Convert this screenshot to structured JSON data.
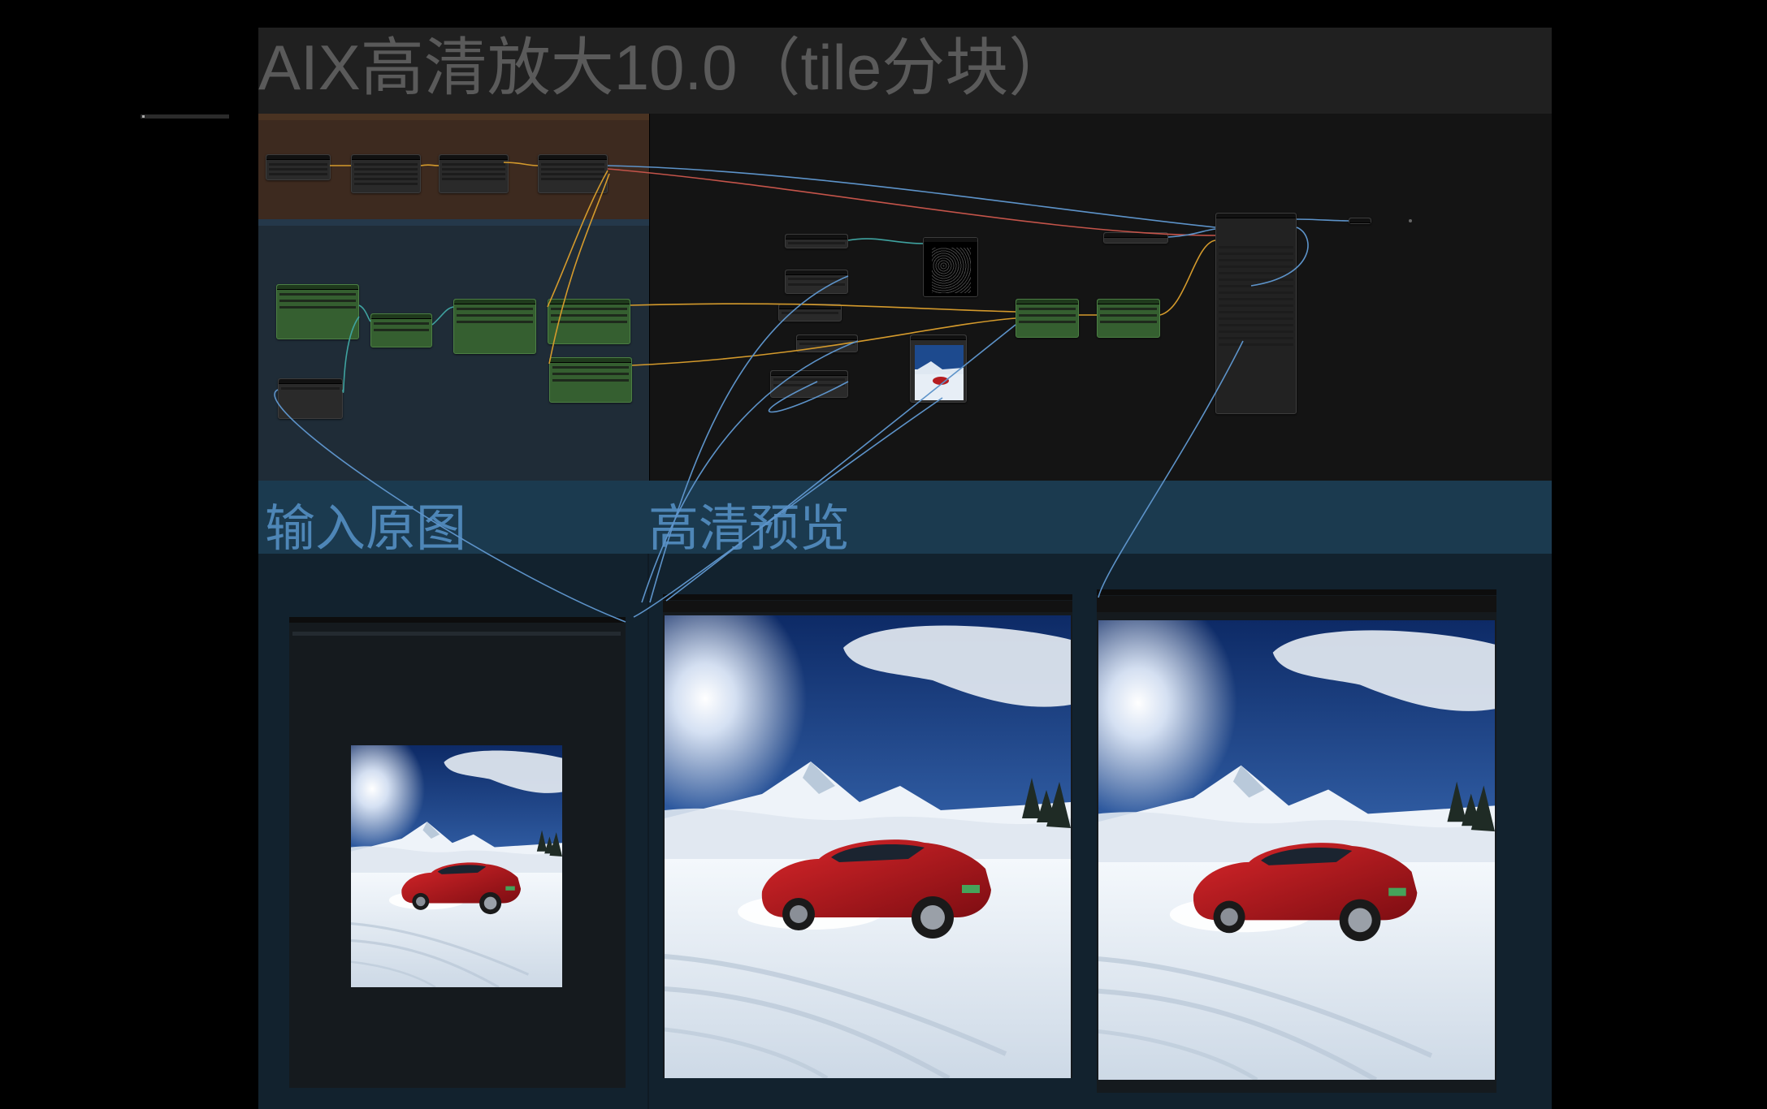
{
  "workflow": {
    "title": "AIX高清放大10.0（tile分块）"
  },
  "groups": {
    "input_label": "输入原图",
    "preview_label": "高清预览"
  },
  "colors": {
    "canvas_bg": "#000000",
    "title_group_bg": "#202020",
    "load_group_bg": "#3d2a1f",
    "sampler_group_bg": "#1f2c37",
    "output_group_bg": "#141414",
    "label_band_bg": "#1b3a4f",
    "images_group_bg": "#12222e",
    "node_green": "#355f30",
    "node_dark": "#2a2a2a",
    "link_blue": "#5d93c9",
    "link_orange": "#d49a2c",
    "link_red": "#c4544a",
    "link_teal": "#3fa3a0"
  },
  "images": {
    "input_image": "snowy-red-car-scene",
    "preview_before": "snowy-red-car-scene",
    "preview_after": "snowy-red-car-scene"
  }
}
